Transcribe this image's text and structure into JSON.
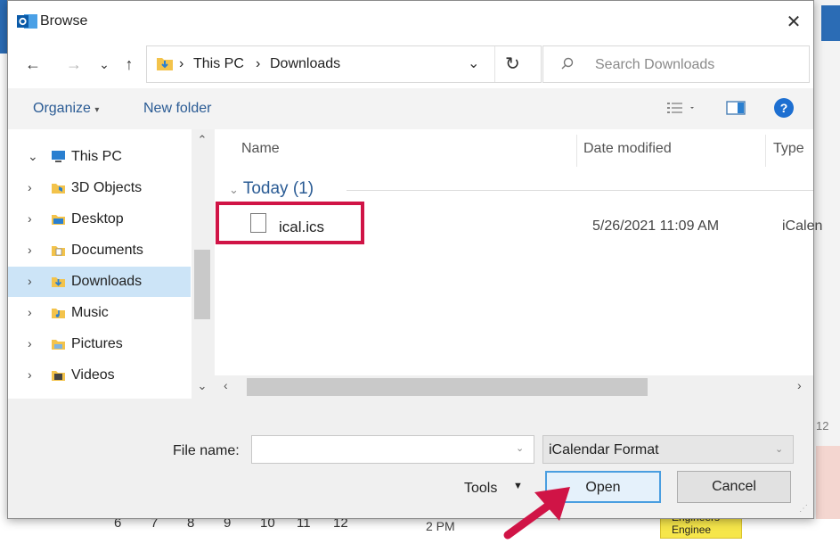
{
  "window": {
    "title": "Browse",
    "close_glyph": "✕"
  },
  "nav": {
    "back": "←",
    "forward": "→",
    "recent": "⌄",
    "up": "↑",
    "breadcrumb": [
      "This PC",
      "Downloads"
    ],
    "separator": "›",
    "dropdown": "⌄",
    "refresh": "↻",
    "search_placeholder": "Search Downloads"
  },
  "toolbar": {
    "organize": "Organize",
    "new_folder": "New folder",
    "help": "?"
  },
  "tree": [
    {
      "label": "This PC",
      "chevron": "⌄",
      "icon": "pc-icon",
      "selected": false
    },
    {
      "label": "3D Objects",
      "chevron": "›",
      "icon": "3d-objects-folder-icon",
      "selected": false
    },
    {
      "label": "Desktop",
      "chevron": "›",
      "icon": "desktop-folder-icon",
      "selected": false
    },
    {
      "label": "Documents",
      "chevron": "›",
      "icon": "documents-folder-icon",
      "selected": false
    },
    {
      "label": "Downloads",
      "chevron": "›",
      "icon": "downloads-folder-icon",
      "selected": true
    },
    {
      "label": "Music",
      "chevron": "›",
      "icon": "music-folder-icon",
      "selected": false
    },
    {
      "label": "Pictures",
      "chevron": "›",
      "icon": "pictures-folder-icon",
      "selected": false
    },
    {
      "label": "Videos",
      "chevron": "›",
      "icon": "videos-folder-icon",
      "selected": false
    }
  ],
  "columns": {
    "name": "Name",
    "date": "Date modified",
    "type": "Type"
  },
  "group": {
    "label": "Today (1)",
    "chevron": "⌄"
  },
  "files": [
    {
      "name": "ical.ics",
      "date": "5/26/2021 11:09 AM",
      "type": "iCalen"
    }
  ],
  "bottom": {
    "file_name_label": "File name:",
    "file_name_value": "",
    "file_type": "iCalendar Format",
    "tools": "Tools",
    "open": "Open",
    "cancel": "Cancel"
  },
  "background": {
    "numbers": [
      "6",
      "7",
      "8",
      "9",
      "10",
      "11",
      "12"
    ],
    "time": "2 PM",
    "event": "Engineers\nEnginee",
    "side_number": "12"
  },
  "colors": {
    "highlight": "#d01446",
    "accent": "#2a5b94",
    "selection": "#cce4f7"
  }
}
